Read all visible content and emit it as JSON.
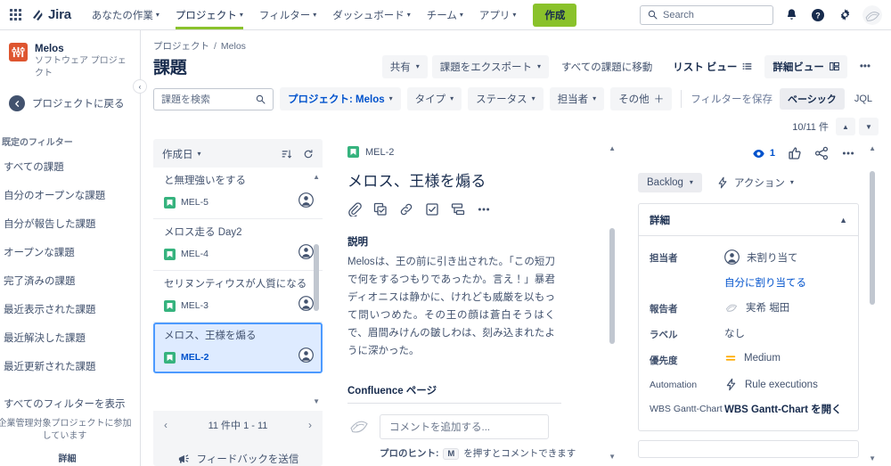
{
  "topnav": {
    "app_switcher": "app-switcher",
    "brand": "Jira",
    "items": [
      {
        "label": "あなたの作業",
        "active": false
      },
      {
        "label": "プロジェクト",
        "active": true
      },
      {
        "label": "フィルター",
        "active": false
      },
      {
        "label": "ダッシュボード",
        "active": false
      },
      {
        "label": "チーム",
        "active": false
      },
      {
        "label": "アプリ",
        "active": false
      }
    ],
    "create_label": "作成",
    "search_placeholder": "Search",
    "notifications_icon": "bell-icon",
    "help_icon": "help-icon",
    "settings_icon": "gear-icon",
    "profile_icon": "avatar"
  },
  "sidebar": {
    "project_name": "Melos",
    "project_type": "ソフトウェア プロジェクト",
    "back_label": "プロジェクトに戻る",
    "section_title": "既定のフィルター",
    "items": [
      {
        "label": "すべての課題"
      },
      {
        "label": "自分のオープンな課題"
      },
      {
        "label": "自分が報告した課題"
      },
      {
        "label": "オープンな課題"
      },
      {
        "label": "完了済みの課題"
      },
      {
        "label": "最近表示された課題"
      },
      {
        "label": "最近解決した課題"
      },
      {
        "label": "最近更新された課題"
      }
    ],
    "show_all": "すべてのフィルターを表示",
    "note": "企業管理対象プロジェクトに参加しています",
    "note_more": "詳細",
    "collapse_icon": "chevron-left-icon"
  },
  "header": {
    "breadcrumb_root": "プロジェクト",
    "breadcrumb_sep": "/",
    "breadcrumb_current": "Melos",
    "title": "課題",
    "actions": {
      "share": "共有",
      "export": "課題をエクスポート",
      "goto_all": "すべての課題に移動",
      "list_view": "リスト ビュー",
      "detail_view": "詳細ビュー",
      "more": "•••"
    }
  },
  "filters": {
    "search_placeholder": "課題を検索",
    "chips": [
      {
        "label": "プロジェクト: Melos",
        "selected": true
      },
      {
        "label": "タイプ",
        "selected": false
      },
      {
        "label": "ステータス",
        "selected": false
      },
      {
        "label": "担当者",
        "selected": false
      }
    ],
    "more_label": "その他",
    "save_label": "フィルターを保存",
    "basic_label": "ベーシック",
    "jql_label": "JQL"
  },
  "counter": {
    "text": "10/11 件",
    "up": "prev-issue",
    "down": "next-issue"
  },
  "issue_list": {
    "sort_label": "作成日",
    "sort_order_icon": "sort-descending-icon",
    "refresh_icon": "refresh-icon",
    "rows": [
      {
        "summary": "と無理強いをする",
        "key": "MEL-5",
        "selected": false
      },
      {
        "summary": "メロス走る  Day2",
        "key": "MEL-4",
        "selected": false
      },
      {
        "summary": "セリヌンティウスが人質になる",
        "key": "MEL-3",
        "selected": false
      },
      {
        "summary": "メロス、王様を煽る",
        "key": "MEL-2",
        "selected": true
      }
    ],
    "pagination": "11 件中 1 - 11",
    "prev": "‹",
    "next": "›",
    "feedback": "フィードバックを送信"
  },
  "detail": {
    "key": "MEL-2",
    "title": "メロス、王様を煽る",
    "actions": [
      {
        "name": "attach-icon"
      },
      {
        "name": "child-issue-icon"
      },
      {
        "name": "link-icon"
      },
      {
        "name": "checklist-icon"
      },
      {
        "name": "subtask-icon"
      },
      {
        "name": "more-icon"
      }
    ],
    "description_label": "説明",
    "description": "Melosは、王の前に引き出された。「この短刀で何をするつもりであったか。言え！」暴君ディオニスは静かに、けれども威厳を以もって問いつめた。その王の顔は蒼白そうはくで、眉間みけんの皺しわは、刻み込まれたように深かった。",
    "confluence_label": "Confluence ページ",
    "comment_placeholder": "コメントを追加する...",
    "hint_prefix": "プロのヒント:",
    "hint_key": "M",
    "hint_suffix": "を押すとコメントできます"
  },
  "right_panel": {
    "watch_count": "1",
    "watch_icon": "eye-icon",
    "like_icon": "thumbs-up-icon",
    "share_icon": "share-icon",
    "more_icon": "more-icon",
    "status": "Backlog",
    "action_label": "アクション",
    "action_icon": "bolt-icon",
    "details_title": "詳細",
    "fields": [
      {
        "label": "担当者",
        "value": "未割り当て",
        "sub_link": "自分に割り当てる",
        "icon": "person-icon",
        "bold_label": true
      },
      {
        "label": "報告者",
        "value": "実希 堀田",
        "icon": "avatar",
        "bold_label": true
      },
      {
        "label": "ラベル",
        "value": "なし",
        "icon": null,
        "bold_label": true
      },
      {
        "label": "優先度",
        "value": "Medium",
        "icon": "priority-medium-icon",
        "bold_label": true
      },
      {
        "label": "Automation",
        "value": "Rule executions",
        "icon": "bolt-icon",
        "bold_label": false
      },
      {
        "label": "WBS Gantt-Chart",
        "value": "WBS Gantt-Chart を開く",
        "icon": null,
        "bold_label": false,
        "bold_value": true
      }
    ]
  },
  "colors": {
    "brand_blue": "#0052cc",
    "create_green": "#8ac22b",
    "issue_type_green": "#36b37e",
    "selected_row": "#deebff",
    "priority_medium": "#ffab00",
    "project_avatar": "#de552f"
  }
}
